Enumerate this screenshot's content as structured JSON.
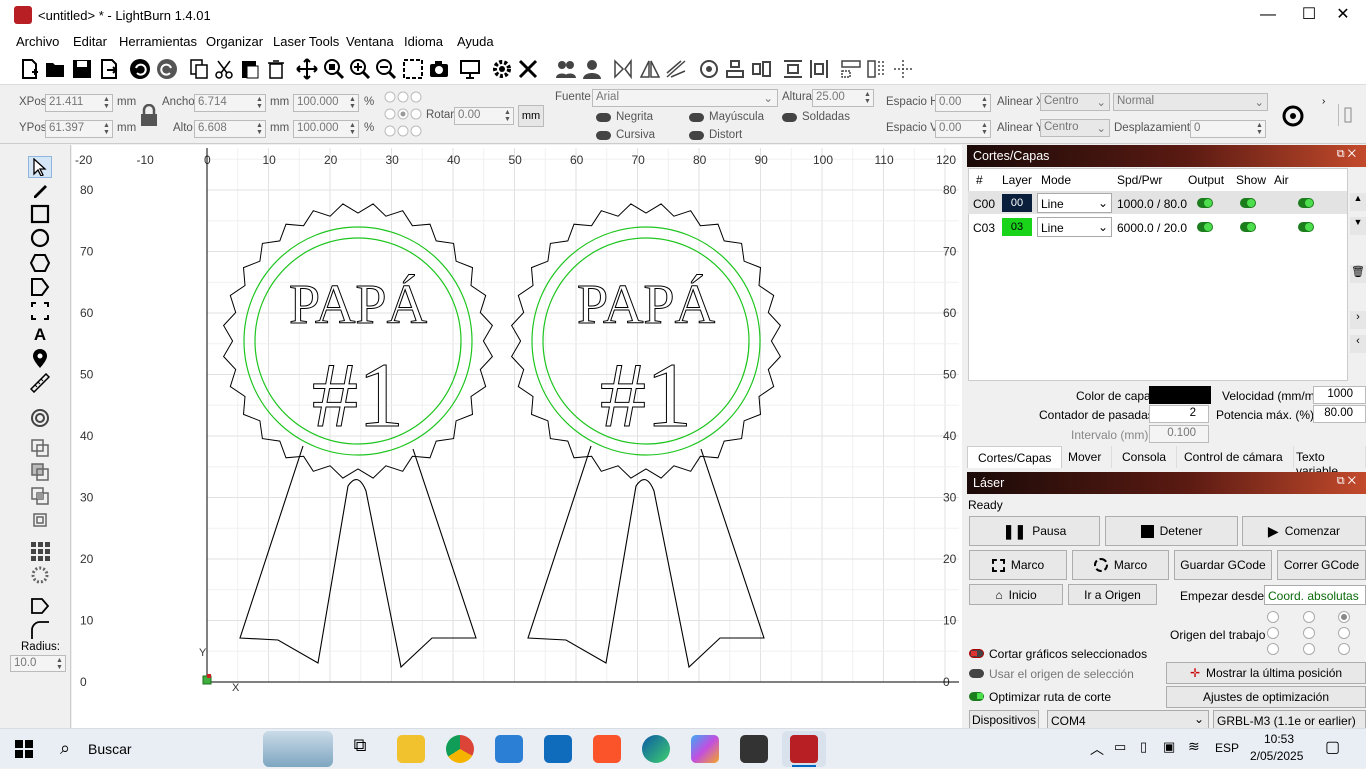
{
  "window": {
    "title": "<untitled> * - LightBurn 1.4.01"
  },
  "menu": [
    "Archivo",
    "Editar",
    "Herramientas",
    "Organizar",
    "Laser Tools",
    "Ventana",
    "Idioma",
    "Ayuda"
  ],
  "props": {
    "xpos_label": "XPos",
    "xpos": "21.411",
    "ypos_label": "YPos",
    "ypos": "61.397",
    "unit": "mm",
    "ancho_label": "Ancho",
    "ancho": "6.714",
    "alto_label": "Alto",
    "alto": "6.608",
    "scale_w": "100.000",
    "scale_h": "100.000",
    "pct": "%",
    "rotar_label": "Rotar",
    "rotar": "0.00",
    "rotar_unit": "mm",
    "fuente_label": "Fuente",
    "fuente": "Arial",
    "altura_label": "Altura",
    "altura": "25.00",
    "negrita": "Negrita",
    "cursiva": "Cursiva",
    "mayuscula": "Mayúscula",
    "distort": "Distort",
    "soldadas": "Soldadas",
    "espacio_h_label": "Espacio H",
    "espacio_h": "0.00",
    "espacio_v_label": "Espacio V",
    "espacio_v": "0.00",
    "alinear_x_label": "Alinear X",
    "alinear_x": "Centro",
    "alinear_y_label": "Alinear Y",
    "alinear_y": "Centro",
    "normal": "Normal",
    "desplazamiento_label": "Desplazamiento",
    "desplazamiento": "0"
  },
  "tools": {
    "radius_label": "Radius:",
    "radius": "10.0"
  },
  "canvas": {
    "x_ticks": [
      "-20",
      "-10",
      "0",
      "10",
      "20",
      "30",
      "40",
      "50",
      "60",
      "70",
      "80",
      "90",
      "100",
      "110",
      "120"
    ],
    "y_ticks": [
      "80",
      "70",
      "60",
      "50",
      "40",
      "30",
      "20",
      "10",
      "0"
    ],
    "x_axis_letter": "X",
    "y_axis_letter": "Y",
    "badge_text": "PAPÁ",
    "badge_number": "#1"
  },
  "layers_panel": {
    "title": "Cortes/Capas",
    "columns": [
      "#",
      "Layer",
      "Mode",
      "Spd/Pwr",
      "Output",
      "Show",
      "Air"
    ],
    "rows": [
      {
        "id": "C00",
        "layer": "00",
        "mode": "Line",
        "spdpwr": "1000.0 / 80.0",
        "color": "#0a1f3c"
      },
      {
        "id": "C03",
        "layer": "03",
        "mode": "Line",
        "spdpwr": "6000.0 / 20.0",
        "color": "#19d419"
      }
    ],
    "color_capa_label": "Color de capa",
    "velocidad_label": "Velocidad (mm/m)",
    "velocidad": "1000",
    "contador_label": "Contador de pasadas",
    "contador": "2",
    "potencia_label": "Potencia máx. (%)",
    "potencia": "80.00",
    "intervalo_label": "Intervalo (mm)",
    "intervalo": "0.100",
    "tabs": [
      "Cortes/Capas",
      "Mover",
      "Consola",
      "Control de cámara",
      "Texto variable"
    ]
  },
  "laser_panel": {
    "title": "Láser",
    "status": "Ready",
    "pausa": "Pausa",
    "detener": "Detener",
    "comenzar": "Comenzar",
    "marco1": "Marco",
    "marco2": "Marco",
    "guardar": "Guardar GCode",
    "correr": "Correr GCode",
    "inicio": "Inicio",
    "ir_origen": "Ir a Origen",
    "empezar_label": "Empezar desde:",
    "empezar": "Coord. absolutas",
    "origen_label": "Origen del trabajo",
    "cortar": "Cortar gráficos seleccionados",
    "usar_origen": "Usar el origen de selección",
    "optimizar": "Optimizar ruta de corte",
    "mostrar": "Mostrar la última posición",
    "ajustes": "Ajustes de optimización",
    "dispositivos": "Dispositivos",
    "port": "COM4",
    "device": "GRBL-M3 (1.1e or earlier)"
  },
  "taskbar": {
    "search": "Buscar",
    "lang": "ESP",
    "time": "10:53",
    "date": "2/05/2025"
  }
}
